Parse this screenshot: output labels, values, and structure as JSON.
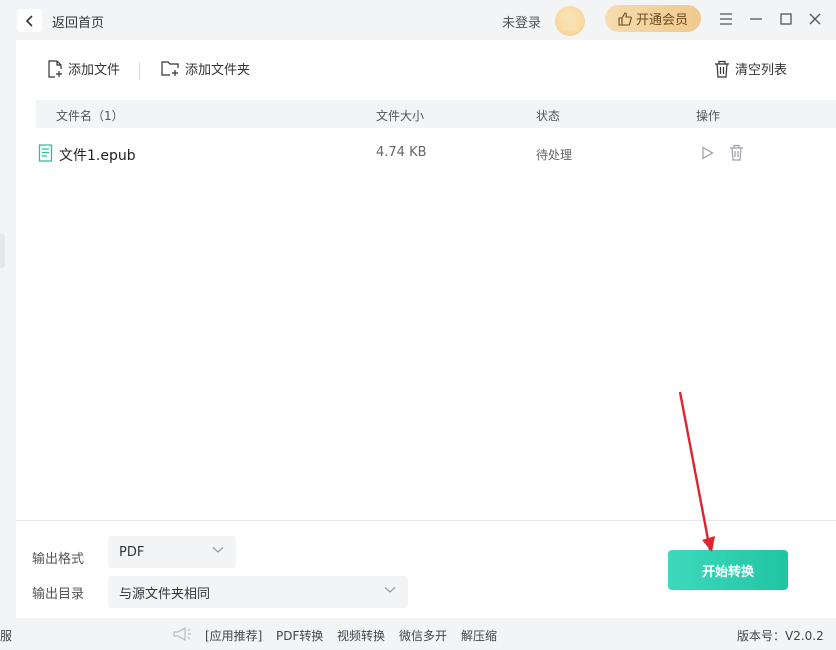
{
  "header": {
    "back_label": "返回首页",
    "login_text": "未登录",
    "vip_label": "开通会员"
  },
  "toolbar": {
    "add_file": "添加文件",
    "add_folder": "添加文件夹",
    "clear_list": "清空列表"
  },
  "table": {
    "headers": [
      "文件名（1）",
      "文件大小",
      "状态",
      "操作"
    ],
    "rows": [
      {
        "name": "文件1.epub",
        "size": "4.74 KB",
        "status": "待处理"
      }
    ]
  },
  "options": {
    "format_label": "输出格式",
    "format_value": "PDF",
    "dir_label": "输出目录",
    "dir_value": "与源文件夹相同"
  },
  "start_button": "开始转换",
  "footer": {
    "edge_text": "服",
    "links": [
      "[应用推荐]",
      "PDF转换",
      "视频转换",
      "微信多开",
      "解压缩"
    ],
    "version": "版本号：V2.0.2"
  },
  "colors": {
    "accent": "#1fc5a3",
    "arrow": "#e0242e",
    "vip_bg": "#f0c98e"
  },
  "icons": [
    "chevron-left-icon",
    "user-avatar-icon",
    "thumbs-up-icon",
    "menu-icon",
    "minimize-icon",
    "maximize-icon",
    "close-icon",
    "add-file-icon",
    "add-folder-icon",
    "trash-icon",
    "document-icon",
    "play-icon",
    "delete-icon",
    "chevron-down-icon",
    "megaphone-icon"
  ]
}
